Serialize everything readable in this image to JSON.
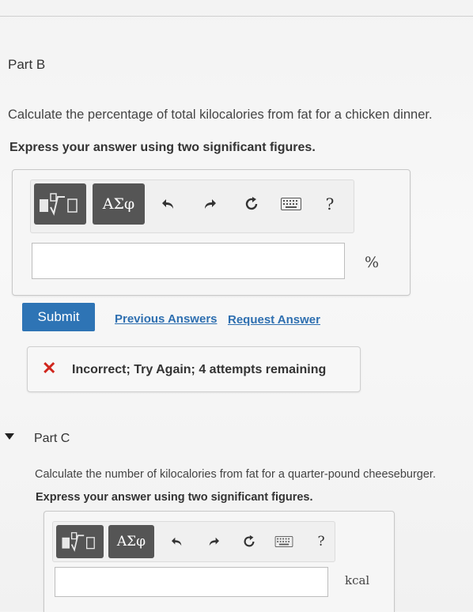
{
  "partB": {
    "title": "Part B",
    "question": "Calculate the percentage of total kilocalories from fat for a chicken dinner.",
    "instruction": "Express your answer using two significant figures.",
    "toolbar": {
      "templates_icon": "fraction-sqrt-template-icon",
      "symbols_label": "ΑΣφ",
      "undo_icon": "undo-icon",
      "redo_icon": "redo-icon",
      "reset_icon": "reset-icon",
      "keyboard_icon": "keyboard-icon",
      "help_label": "?"
    },
    "answer_value": "",
    "unit": "%",
    "submit_label": "Submit",
    "previous_answers_label": "Previous Answers",
    "request_answer_label": "Request Answer",
    "feedback": {
      "icon": "x-icon",
      "color": "#d0261d",
      "message": "Incorrect; Try Again; 4 attempts remaining"
    }
  },
  "partC": {
    "title": "Part C",
    "question": "Calculate the number of kilocalories from fat for a quarter-pound cheeseburger.",
    "instruction": "Express your answer using two significant figures.",
    "toolbar": {
      "symbols_label": "ΑΣφ",
      "help_label": "?"
    },
    "answer_value": "",
    "unit": "kcal"
  },
  "colors": {
    "accent": "#2e74b5",
    "link": "#2e6fb0",
    "error": "#d0261d"
  }
}
